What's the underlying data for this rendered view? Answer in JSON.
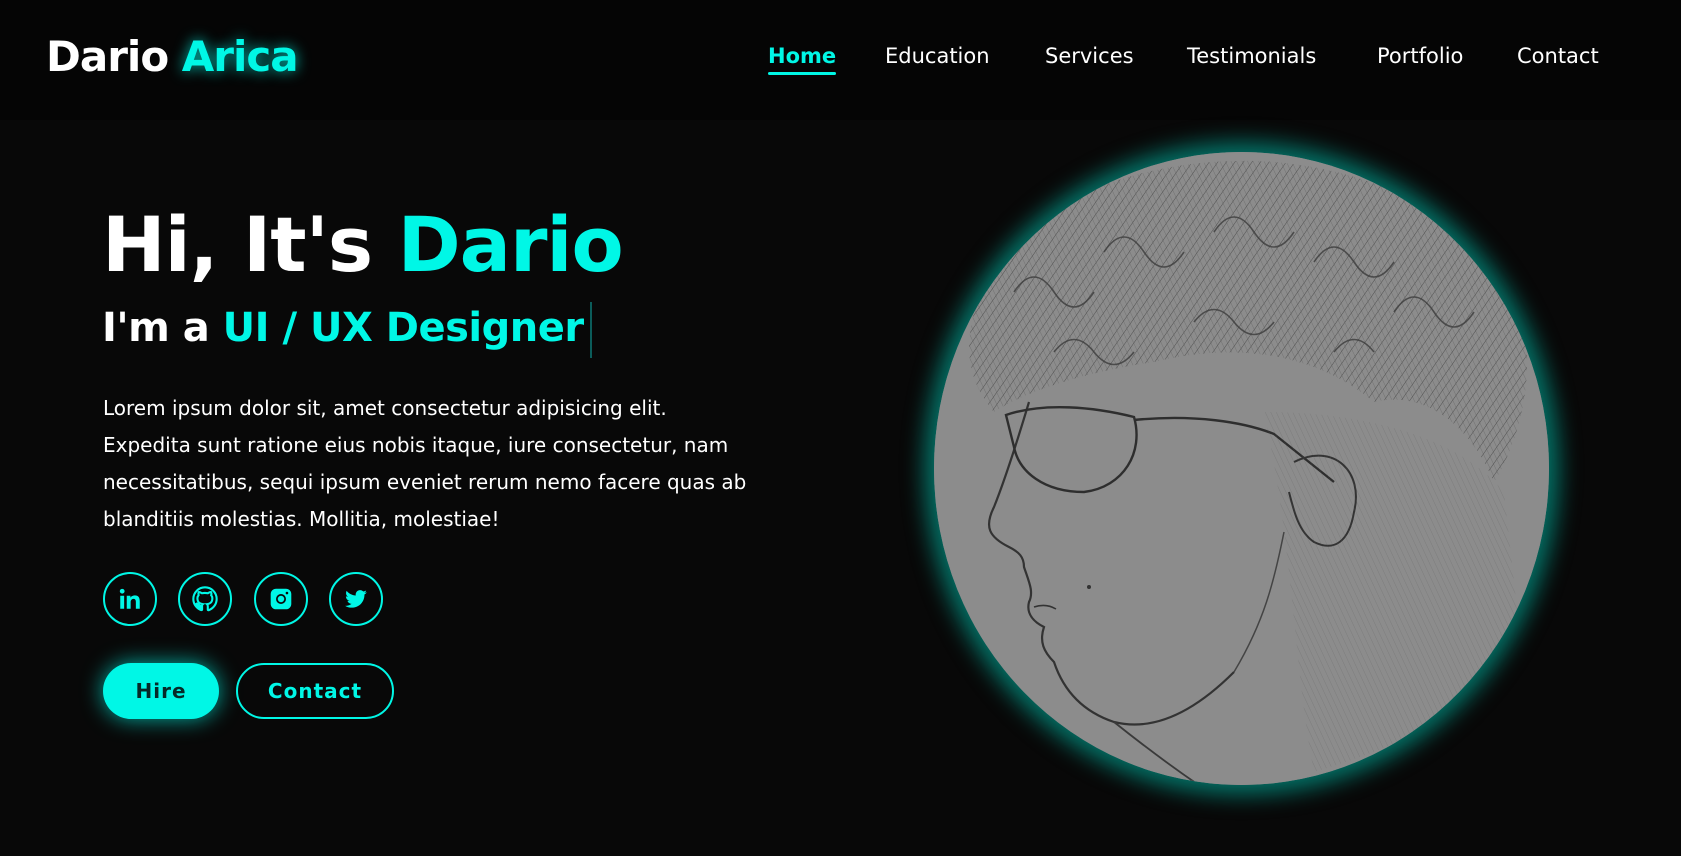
{
  "logo": {
    "first": "Dario",
    "last": "Arica"
  },
  "nav": {
    "items": [
      {
        "label": "Home",
        "active": true
      },
      {
        "label": "Education",
        "active": false
      },
      {
        "label": "Services",
        "active": false
      },
      {
        "label": "Testimonials",
        "active": false
      },
      {
        "label": "Portfolio",
        "active": false
      },
      {
        "label": "Contact",
        "active": false
      }
    ]
  },
  "hero": {
    "greeting": "Hi, It's",
    "name": "Dario",
    "role_prefix": "I'm a",
    "role": "UI / UX Designer",
    "intro": "Lorem ipsum dolor sit, amet consectetur adipisicing elit. Expedita sunt ratione eius nobis itaque, iure consectetur, nam necessitatibus, sequi ipsum eveniet rerum nemo facere quas ab blanditiis molestias. Mollitia, molestiae!"
  },
  "socials": [
    {
      "icon": "linkedin-icon"
    },
    {
      "icon": "github-icon"
    },
    {
      "icon": "instagram-icon"
    },
    {
      "icon": "twitter-icon"
    }
  ],
  "buttons": {
    "hire": "Hire",
    "contact": "Contact"
  },
  "colors": {
    "accent": "#00f7e6",
    "background": "#080808",
    "header": "#050505"
  }
}
